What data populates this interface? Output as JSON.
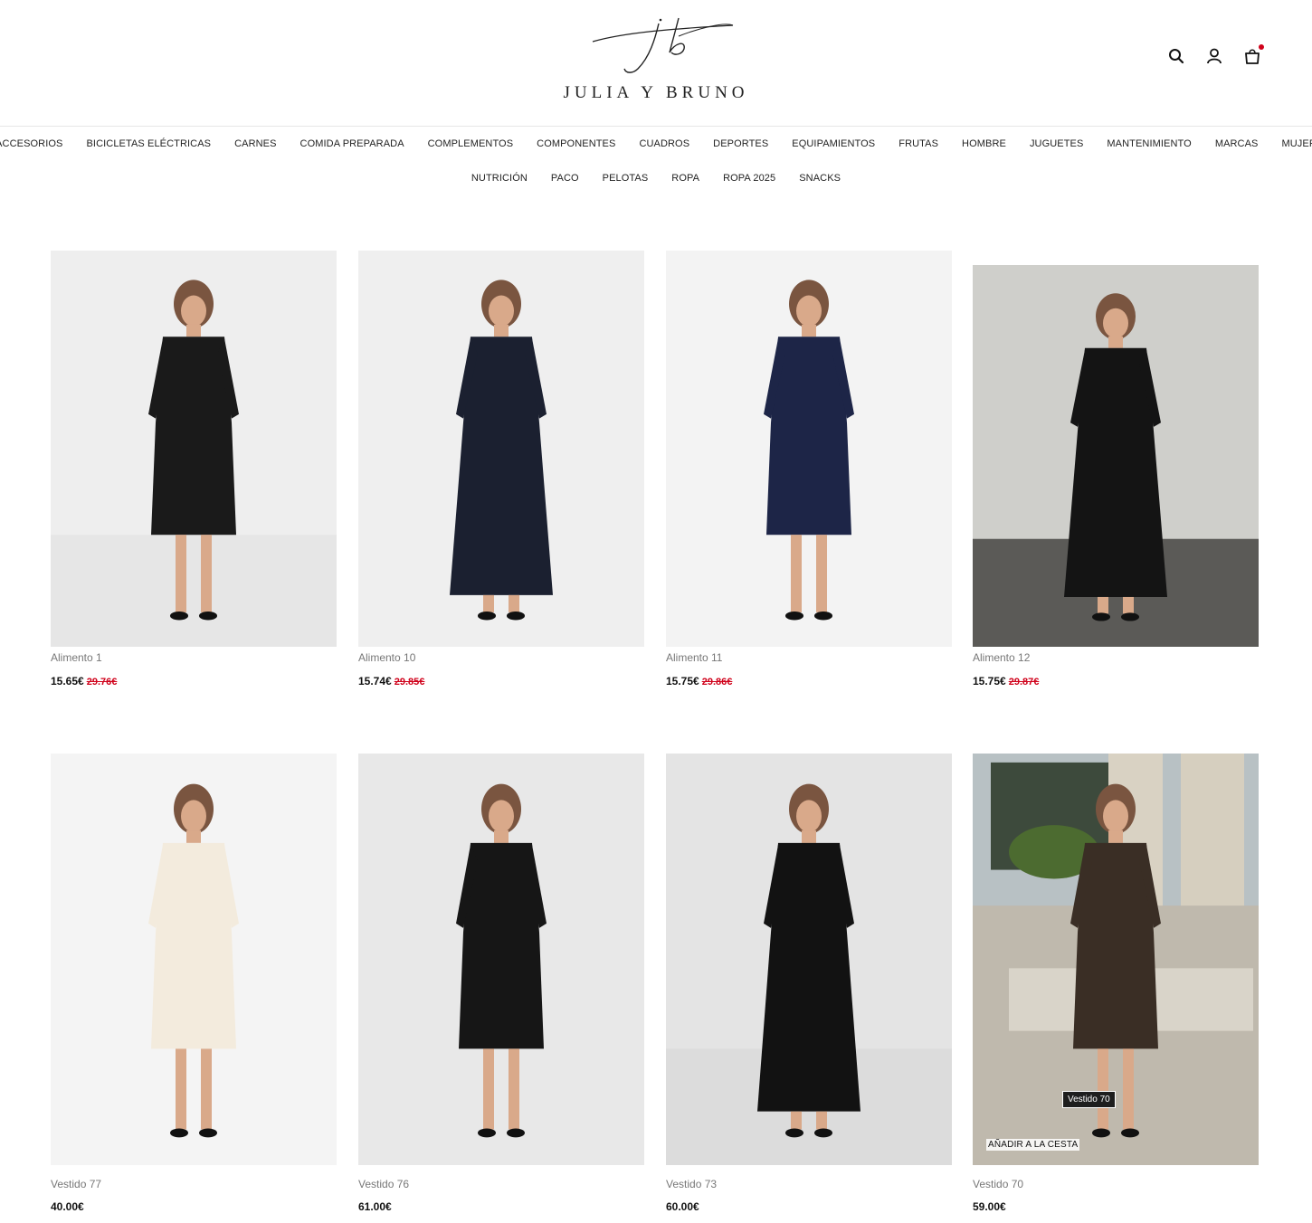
{
  "brand": {
    "monogram": "jb",
    "name": "JULIA Y BRUNO"
  },
  "header_icons": [
    "search-icon",
    "user-icon",
    "cart-icon"
  ],
  "nav": {
    "row1": [
      "ACCESORIOS",
      "BICICLETAS ELÉCTRICAS",
      "CARNES",
      "COMIDA PREPARADA",
      "COMPLEMENTOS",
      "COMPONENTES",
      "CUADROS",
      "DEPORTES",
      "EQUIPAMIENTOS",
      "FRUTAS",
      "HOMBRE",
      "JUGUETES",
      "MANTENIMIENTO",
      "MARCAS",
      "MUJER"
    ],
    "row2": [
      "NUTRICIÓN",
      "PACO",
      "PELOTAS",
      "ROPA",
      "ROPA 2025",
      "SNACKS"
    ]
  },
  "products": [
    {
      "name": "Alimento 1",
      "price": "15.65€",
      "old_price": "29.76€",
      "dress_color": "#1a1a1a",
      "bg": "#eeeeee",
      "floor": "#e6e6e6"
    },
    {
      "name": "Alimento 10",
      "price": "15.74€",
      "old_price": "29.85€",
      "dress_color": "#1b2030",
      "bg": "#efefef",
      "floor": "#efefef"
    },
    {
      "name": "Alimento 11",
      "price": "15.75€",
      "old_price": "29.86€",
      "dress_color": "#1d2547",
      "bg": "#f3f3f3",
      "floor": "#f3f3f3"
    },
    {
      "name": "Alimento 12",
      "price": "15.75€",
      "old_price": "29.87€",
      "dress_color": "#141414",
      "bg": "#cfcfcb",
      "floor": "#5b5a57"
    },
    {
      "name": "Vestido 77",
      "price": "40.00€",
      "old_price": "",
      "dress_color": "#f3ebdd",
      "bg": "#f4f4f4",
      "floor": "#f4f4f4"
    },
    {
      "name": "Vestido 76",
      "price": "61.00€",
      "old_price": "",
      "dress_color": "#161616",
      "bg": "#e8e8e8",
      "floor": "#e8e8e8"
    },
    {
      "name": "Vestido 73",
      "price": "60.00€",
      "old_price": "",
      "dress_color": "#121212",
      "bg": "#e4e4e4",
      "floor": "#dcdcdc"
    },
    {
      "name": "Vestido 70",
      "price": "59.00€",
      "old_price": "",
      "dress_color": "#3a2e25",
      "bg": "#9aa3a8",
      "floor": "#cfcac0"
    }
  ],
  "hover": {
    "tooltip": "Vestido 70",
    "add_to_cart": "AÑADIR A LA CESTA"
  }
}
